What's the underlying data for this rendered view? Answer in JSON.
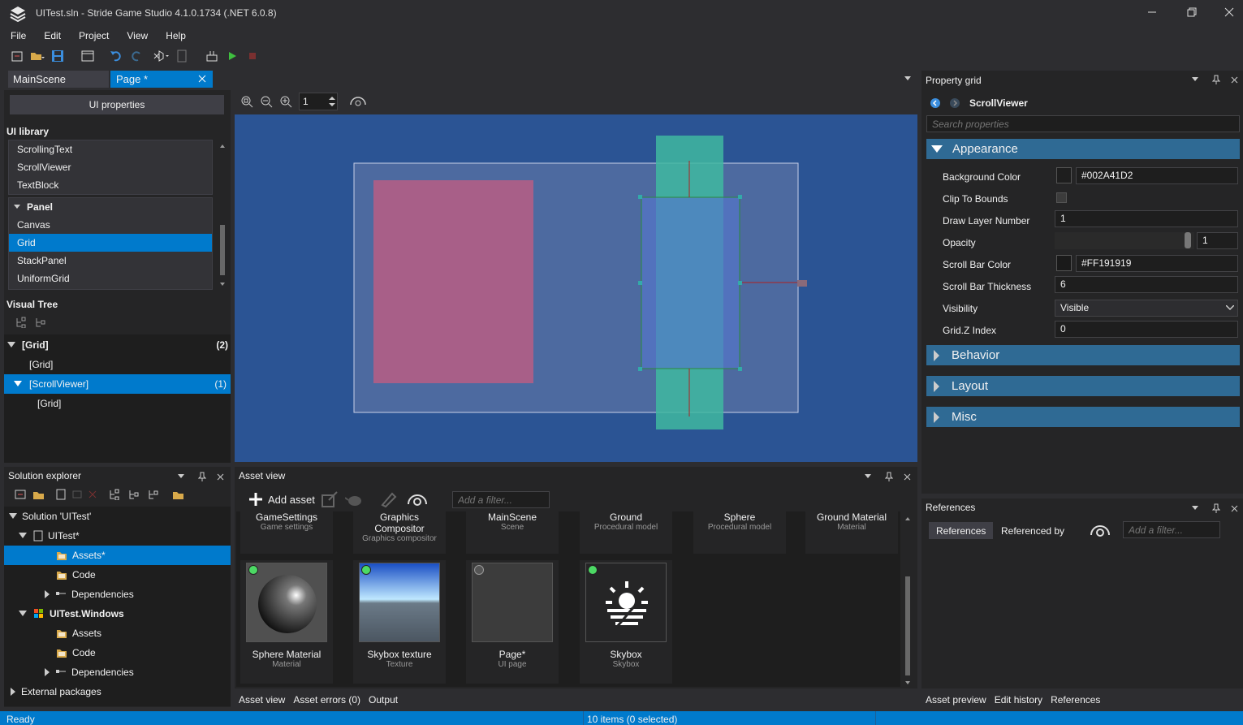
{
  "window": {
    "title": "UITest.sln - Stride Game Studio 4.1.0.1734 (.NET 6.0.8)",
    "controls": [
      "minimize",
      "restore",
      "close"
    ]
  },
  "menu": [
    "File",
    "Edit",
    "Project",
    "View",
    "Help"
  ],
  "toolbar_icons": [
    "new-icon",
    "open-folder-icon",
    "save-icon",
    "window-icon",
    "undo-icon",
    "redo-icon",
    "visual-studio-icon",
    "document-icon",
    "build-icon",
    "play-icon",
    "stop-icon"
  ],
  "editor_tabs": [
    {
      "label": "MainScene",
      "active": false
    },
    {
      "label": "Page *",
      "active": true
    }
  ],
  "left": {
    "ui_properties_button": "UI properties",
    "library_title": "UI library",
    "library_items": [
      "ScrollingText",
      "ScrollViewer",
      "TextBlock"
    ],
    "panel_group": "Panel",
    "panel_items": [
      "Canvas",
      "Grid",
      "StackPanel",
      "UniformGrid"
    ],
    "panel_selected": "Grid",
    "visual_tree_title": "Visual Tree",
    "tree": [
      {
        "label": "[Grid]",
        "count": "(2)",
        "level": 0,
        "expanded": true,
        "selected": false
      },
      {
        "label": "[Grid]",
        "count": "",
        "level": 1,
        "expanded": false,
        "selected": false
      },
      {
        "label": "[ScrollViewer]",
        "count": "(1)",
        "level": 0,
        "expanded": true,
        "selected": true
      },
      {
        "label": "[Grid]",
        "count": "",
        "level": 2,
        "expanded": false,
        "selected": false
      }
    ]
  },
  "viewport": {
    "zoom_value": "1",
    "background_color": "#2b5494"
  },
  "property_grid": {
    "title": "Property grid",
    "object_name": "ScrollViewer",
    "search_placeholder": "Search properties",
    "appearance_label": "Appearance",
    "properties": [
      {
        "label": "Background Color",
        "value": "#002A41D2",
        "swatch": true
      },
      {
        "label": "Clip To Bounds",
        "value": "",
        "checkbox": true
      },
      {
        "label": "Draw Layer Number",
        "value": "1"
      },
      {
        "label": "Opacity",
        "value": "1",
        "slider": true
      },
      {
        "label": "Scroll Bar Color",
        "value": "#FF191919",
        "swatch": true
      },
      {
        "label": "Scroll Bar Thickness",
        "value": "6"
      },
      {
        "label": "Visibility",
        "value": "Visible",
        "dropdown": true
      },
      {
        "label": "Grid.Z Index",
        "value": "0"
      }
    ],
    "categories": [
      "Behavior",
      "Layout",
      "Misc"
    ]
  },
  "solution_explorer": {
    "title": "Solution explorer",
    "tree": [
      {
        "label": "Solution 'UITest'",
        "level": 0,
        "arrow": "down",
        "icon": "",
        "bold": false,
        "selected": false
      },
      {
        "label": "UITest*",
        "level": 1,
        "arrow": "down",
        "icon": "project-icon",
        "bold": false,
        "selected": false
      },
      {
        "label": "Assets*",
        "level": 2,
        "arrow": "",
        "icon": "folder-icon",
        "bold": false,
        "selected": true
      },
      {
        "label": "Code",
        "level": 2,
        "arrow": "",
        "icon": "folder-icon",
        "bold": false,
        "selected": false
      },
      {
        "label": "Dependencies",
        "level": 2,
        "arrow": "right",
        "icon": "dependencies-icon",
        "bold": false,
        "selected": false
      },
      {
        "label": "UITest.Windows",
        "level": 1,
        "arrow": "down",
        "icon": "windows-icon",
        "bold": true,
        "selected": false
      },
      {
        "label": "Assets",
        "level": 2,
        "arrow": "",
        "icon": "folder-icon",
        "bold": false,
        "selected": false
      },
      {
        "label": "Code",
        "level": 2,
        "arrow": "",
        "icon": "folder-icon",
        "bold": false,
        "selected": false
      },
      {
        "label": "Dependencies",
        "level": 2,
        "arrow": "right",
        "icon": "dependencies-icon",
        "bold": false,
        "selected": false
      },
      {
        "label": "External packages",
        "level": 0,
        "arrow": "right",
        "icon": "",
        "bold": false,
        "selected": false
      }
    ]
  },
  "asset_view": {
    "title": "Asset view",
    "add_asset_label": "Add asset",
    "filter_placeholder": "Add a filter...",
    "top_row": [
      {
        "name": "GameSettings",
        "type": "Game settings"
      },
      {
        "name": "Graphics\nCompositor",
        "type": "Graphics compositor"
      },
      {
        "name": "MainScene",
        "type": "Scene"
      },
      {
        "name": "Ground",
        "type": "Procedural model"
      },
      {
        "name": "Sphere",
        "type": "Procedural model"
      },
      {
        "name": "Ground Material",
        "type": "Material"
      }
    ],
    "bottom_row": [
      {
        "name": "Sphere Material",
        "type": "Material",
        "thumb": "sphere",
        "status": "green"
      },
      {
        "name": "Skybox texture",
        "type": "Texture",
        "thumb": "sky",
        "status": "green"
      },
      {
        "name": "Page*",
        "type": "UI page",
        "thumb": "blank",
        "status": "grey"
      },
      {
        "name": "Skybox",
        "type": "Skybox",
        "thumb": "skybox-icon",
        "status": "green"
      }
    ],
    "bottom_tabs": [
      "Asset view",
      "Asset errors (0)",
      "Output"
    ]
  },
  "references": {
    "title": "References",
    "tab_active": "References",
    "tab_other": "Referenced by",
    "filter_placeholder": "Add a filter...",
    "bottom_tabs": [
      "Asset preview",
      "Edit history",
      "References"
    ]
  },
  "status": {
    "left": "Ready",
    "center": "10 items (0 selected)"
  }
}
